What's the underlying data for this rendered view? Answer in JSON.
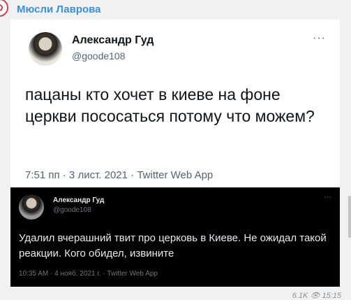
{
  "channel": {
    "name": "Мюсли Лаврова"
  },
  "tweet_light": {
    "author": "Александр Гуд",
    "handle": "@goode108",
    "more": "···",
    "text": "пацаны кто хочет в киеве на фоне церкви пососаться потому что можем?",
    "meta": "7:51 пп · 3 лист. 2021 · Twitter Web App"
  },
  "tweet_dark": {
    "author": "Александр Гуд",
    "handle": "@goode108",
    "more": "···",
    "text": "Удалил вчерашний твит про церковь в Киеве. Не ожидал такой реакции. Кого обидел, извините",
    "meta": "10:35 AM · 4 нояб. 2021 г. · Twitter Web App"
  },
  "post_footer": {
    "views": "6.1K",
    "time": "15:15"
  }
}
